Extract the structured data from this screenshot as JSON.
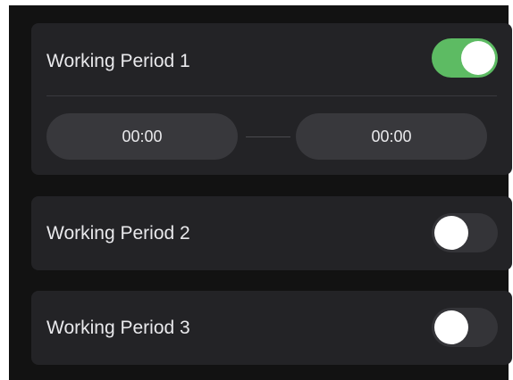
{
  "periods": [
    {
      "label": "Working Period 1",
      "enabled": true,
      "start_time": "00:00",
      "end_time": "00:00"
    },
    {
      "label": "Working Period 2",
      "enabled": false
    },
    {
      "label": "Working Period 3",
      "enabled": false
    }
  ],
  "colors": {
    "screen_background": "#121212",
    "card_background": "#232326",
    "toggle_on": "#5dbb63",
    "toggle_off": "#343438",
    "time_pill": "#38383c",
    "text": "#e9e9ec"
  }
}
